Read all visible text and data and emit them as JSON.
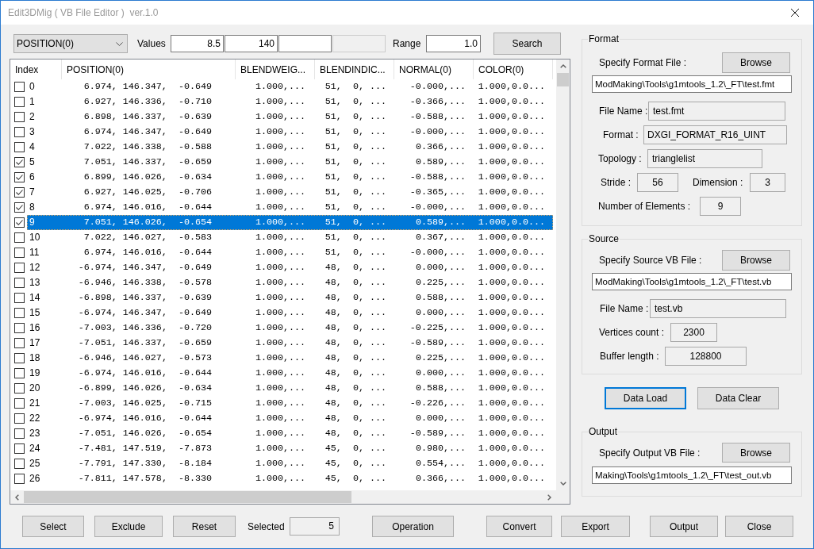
{
  "window": {
    "title": "Edit3DMig ( VB File Editor )  ver.1.0"
  },
  "search_bar": {
    "column": "POSITION(0)",
    "values_label": "Values",
    "values": [
      {
        "value": "8.5",
        "disabled": false
      },
      {
        "value": "140",
        "disabled": false
      },
      {
        "disabled": false
      },
      {
        "disabled": true
      }
    ],
    "range_label": "Range",
    "range": "1.0",
    "search_button": "Search"
  },
  "table": {
    "columns": [
      "Index",
      "POSITION(0)",
      "BLENDWEIG...",
      "BLENDINDIC...",
      "NORMAL(0)",
      "COLOR(0)"
    ],
    "rows": [
      {
        "checked": false,
        "selected": false,
        "cells": [
          "0",
          "6.974, 146.347,  -0.649",
          "1.000,...",
          "51,  0, ...",
          "-0.000,...",
          "1.000,0.0..."
        ]
      },
      {
        "checked": false,
        "selected": false,
        "cells": [
          "1",
          "6.927, 146.336,  -0.710",
          "1.000,...",
          "51,  0, ...",
          "-0.366,...",
          "1.000,0.0..."
        ]
      },
      {
        "checked": false,
        "selected": false,
        "cells": [
          "2",
          "6.898, 146.337,  -0.639",
          "1.000,...",
          "51,  0, ...",
          "-0.588,...",
          "1.000,0.0..."
        ]
      },
      {
        "checked": false,
        "selected": false,
        "cells": [
          "3",
          "6.974, 146.347,  -0.649",
          "1.000,...",
          "51,  0, ...",
          "-0.000,...",
          "1.000,0.0..."
        ]
      },
      {
        "checked": false,
        "selected": false,
        "cells": [
          "4",
          "7.022, 146.338,  -0.588",
          "1.000,...",
          "51,  0, ...",
          "0.366,...",
          "1.000,0.0..."
        ]
      },
      {
        "checked": true,
        "selected": false,
        "cells": [
          "5",
          "7.051, 146.337,  -0.659",
          "1.000,...",
          "51,  0, ...",
          "0.589,...",
          "1.000,0.0..."
        ]
      },
      {
        "checked": true,
        "selected": false,
        "cells": [
          "6",
          "6.899, 146.026,  -0.634",
          "1.000,...",
          "51,  0, ...",
          "-0.588,...",
          "1.000,0.0..."
        ]
      },
      {
        "checked": true,
        "selected": false,
        "cells": [
          "7",
          "6.927, 146.025,  -0.706",
          "1.000,...",
          "51,  0, ...",
          "-0.365,...",
          "1.000,0.0..."
        ]
      },
      {
        "checked": true,
        "selected": false,
        "cells": [
          "8",
          "6.974, 146.016,  -0.644",
          "1.000,...",
          "51,  0, ...",
          "-0.000,...",
          "1.000,0.0..."
        ]
      },
      {
        "checked": true,
        "selected": true,
        "cells": [
          "9",
          "7.051, 146.026,  -0.654",
          "1.000,...",
          "51,  0, ...",
          "0.589,...",
          "1.000,0.0..."
        ]
      },
      {
        "checked": false,
        "selected": false,
        "cells": [
          "10",
          "7.022, 146.027,  -0.583",
          "1.000,...",
          "51,  0, ...",
          "0.367,...",
          "1.000,0.0..."
        ]
      },
      {
        "checked": false,
        "selected": false,
        "cells": [
          "11",
          "6.974, 146.016,  -0.644",
          "1.000,...",
          "51,  0, ...",
          "-0.000,...",
          "1.000,0.0..."
        ]
      },
      {
        "checked": false,
        "selected": false,
        "cells": [
          "12",
          "-6.974, 146.347,  -0.649",
          "1.000,...",
          "48,  0, ...",
          "0.000,...",
          "1.000,0.0..."
        ]
      },
      {
        "checked": false,
        "selected": false,
        "cells": [
          "13",
          "-6.946, 146.338,  -0.578",
          "1.000,...",
          "48,  0, ...",
          "0.225,...",
          "1.000,0.0..."
        ]
      },
      {
        "checked": false,
        "selected": false,
        "cells": [
          "14",
          "-6.898, 146.337,  -0.639",
          "1.000,...",
          "48,  0, ...",
          "0.588,...",
          "1.000,0.0..."
        ]
      },
      {
        "checked": false,
        "selected": false,
        "cells": [
          "15",
          "-6.974, 146.347,  -0.649",
          "1.000,...",
          "48,  0, ...",
          "0.000,...",
          "1.000,0.0..."
        ]
      },
      {
        "checked": false,
        "selected": false,
        "cells": [
          "16",
          "-7.003, 146.336,  -0.720",
          "1.000,...",
          "48,  0, ...",
          "-0.225,...",
          "1.000,0.0..."
        ]
      },
      {
        "checked": false,
        "selected": false,
        "cells": [
          "17",
          "-7.051, 146.337,  -0.659",
          "1.000,...",
          "48,  0, ...",
          "-0.589,...",
          "1.000,0.0..."
        ]
      },
      {
        "checked": false,
        "selected": false,
        "cells": [
          "18",
          "-6.946, 146.027,  -0.573",
          "1.000,...",
          "48,  0, ...",
          "0.225,...",
          "1.000,0.0..."
        ]
      },
      {
        "checked": false,
        "selected": false,
        "cells": [
          "19",
          "-6.974, 146.016,  -0.644",
          "1.000,...",
          "48,  0, ...",
          "0.000,...",
          "1.000,0.0..."
        ]
      },
      {
        "checked": false,
        "selected": false,
        "cells": [
          "20",
          "-6.899, 146.026,  -0.634",
          "1.000,...",
          "48,  0, ...",
          "0.588,...",
          "1.000,0.0..."
        ]
      },
      {
        "checked": false,
        "selected": false,
        "cells": [
          "21",
          "-7.003, 146.025,  -0.715",
          "1.000,...",
          "48,  0, ...",
          "-0.226,...",
          "1.000,0.0..."
        ]
      },
      {
        "checked": false,
        "selected": false,
        "cells": [
          "22",
          "-6.974, 146.016,  -0.644",
          "1.000,...",
          "48,  0, ...",
          "0.000,...",
          "1.000,0.0..."
        ]
      },
      {
        "checked": false,
        "selected": false,
        "cells": [
          "23",
          "-7.051, 146.026,  -0.654",
          "1.000,...",
          "48,  0, ...",
          "-0.589,...",
          "1.000,0.0..."
        ]
      },
      {
        "checked": false,
        "selected": false,
        "cells": [
          "24",
          "-7.481, 147.519,  -7.873",
          "1.000,...",
          "45,  0, ...",
          "0.980,...",
          "1.000,0.0..."
        ]
      },
      {
        "checked": false,
        "selected": false,
        "cells": [
          "25",
          "-7.791, 147.330,  -8.184",
          "1.000,...",
          "45,  0, ...",
          "0.554,...",
          "1.000,0.0..."
        ]
      },
      {
        "checked": false,
        "selected": false,
        "cells": [
          "26",
          "-7.811, 147.578,  -8.330",
          "1.000,...",
          "45,  0, ...",
          "0.366,...",
          "1.000,0.0..."
        ]
      }
    ]
  },
  "format": {
    "title": "Format",
    "file_label": "Specify Format File :",
    "browse_button": "Browse",
    "path": "ModMaking\\Tools\\g1mtools_1.2\\_FT\\test.fmt",
    "rows": [
      [
        {
          "label": "File Name :",
          "value": "test.fmt"
        }
      ],
      [
        {
          "label": "Format :",
          "value": "DXGI_FORMAT_R16_UINT"
        }
      ],
      [
        {
          "label": "Topology :",
          "value": "trianglelist"
        }
      ],
      [
        {
          "label": "Stride :",
          "value": "56"
        },
        {
          "label": "Dimension :",
          "value": "3"
        }
      ],
      [
        {
          "label": "Number of Elements :",
          "value": "9"
        }
      ]
    ]
  },
  "source": {
    "title": "Source",
    "file_label": "Specify Source VB File :",
    "browse_button": "Browse",
    "path": "ModMaking\\Tools\\g1mtools_1.2\\_FT\\test.vb",
    "rows": [
      [
        {
          "label": "File Name :",
          "value": "test.vb"
        }
      ],
      [
        {
          "label": "Vertices count :",
          "value": "2300"
        }
      ],
      [
        {
          "label": "Buffer length :",
          "value": "128800"
        }
      ]
    ]
  },
  "data_buttons": [
    {
      "label": "Data Load",
      "focused": true
    },
    {
      "label": "Data Clear",
      "focused": false
    }
  ],
  "output": {
    "title": "Output",
    "file_label": "Specify Output VB File :",
    "browse_button": "Browse",
    "path": "Making\\Tools\\g1mtools_1.2\\_FT\\test_out.vb"
  },
  "bottom_bar": [
    {
      "kind": "button",
      "label": "Select"
    },
    {
      "kind": "button",
      "label": "Exclude"
    },
    {
      "kind": "button",
      "label": "Reset"
    },
    {
      "kind": "count",
      "label": "Selected",
      "value": "5"
    },
    {
      "kind": "button",
      "label": "Operation"
    },
    {
      "kind": "button",
      "label": "Convert"
    },
    {
      "kind": "button",
      "label": "Export"
    },
    {
      "kind": "button",
      "label": "Output"
    },
    {
      "kind": "button",
      "label": "Close"
    }
  ]
}
